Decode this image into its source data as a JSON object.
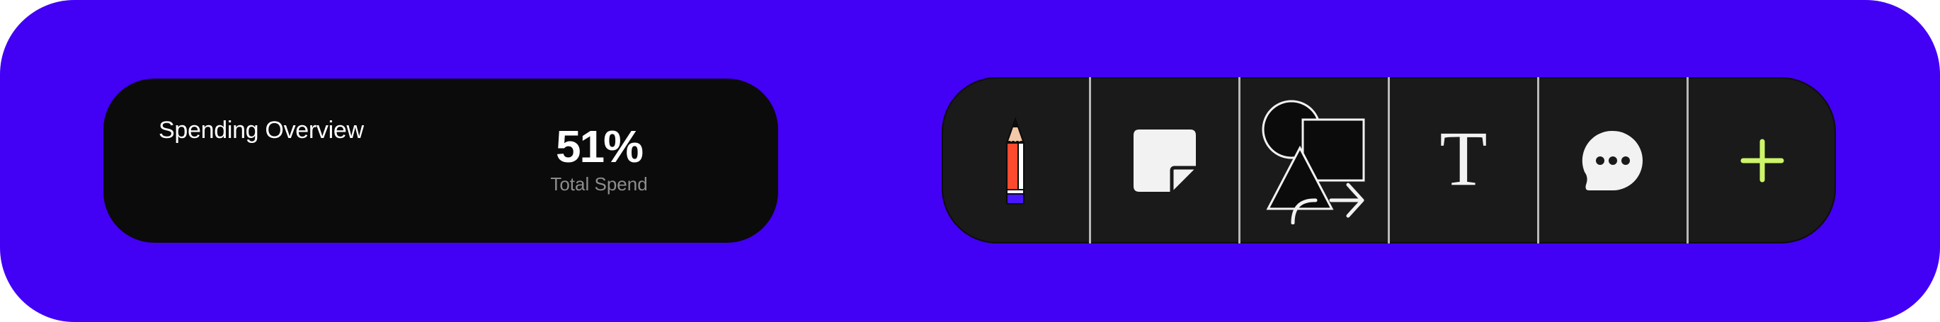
{
  "spending": {
    "title": "Spending Overview",
    "value": "51%",
    "caption": "Total Spend"
  },
  "toolbar": {
    "items": [
      {
        "icon": "pencil-icon"
      },
      {
        "icon": "sticky-note-icon"
      },
      {
        "icon": "shapes-icon"
      },
      {
        "icon": "text-icon",
        "glyph": "T"
      },
      {
        "icon": "comment-icon"
      },
      {
        "icon": "plus-icon"
      }
    ]
  },
  "colors": {
    "background": "#4200f5",
    "card": "#0b0b0b",
    "toolbar": "#1a1a1a",
    "divider": "#b9b9b9",
    "plus": "#cdf56a",
    "pencil_body": "#ff4a2e",
    "pencil_cap": "#4a16ff"
  }
}
